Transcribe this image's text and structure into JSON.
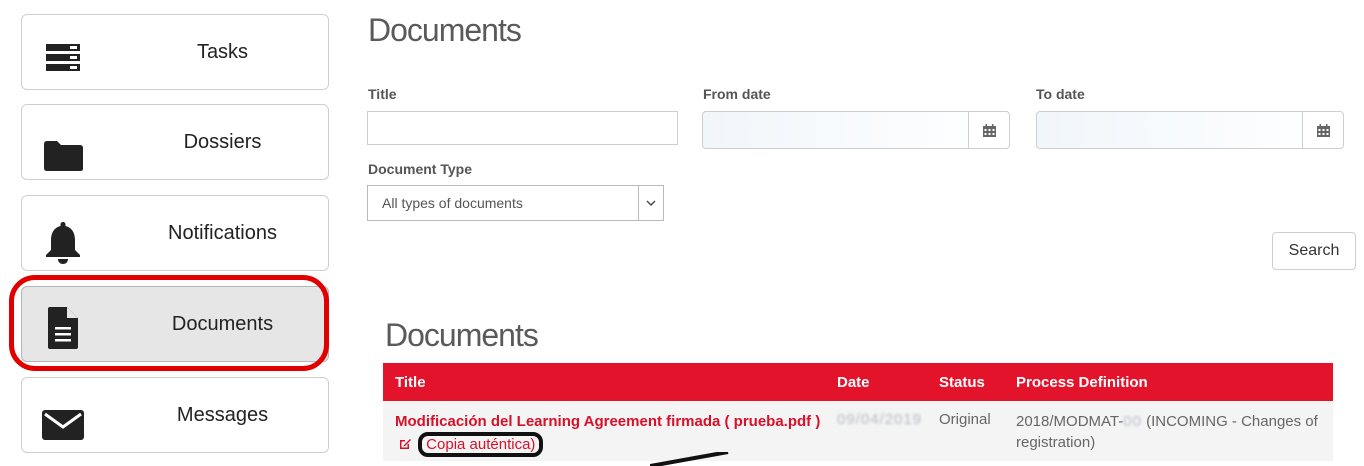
{
  "sidebar": {
    "items": [
      {
        "label": "Tasks",
        "icon": "server-icon"
      },
      {
        "label": "Dossiers",
        "icon": "folder-icon"
      },
      {
        "label": "Notifications",
        "icon": "bell-icon"
      },
      {
        "label": "Documents",
        "icon": "document-icon"
      },
      {
        "label": "Messages",
        "icon": "envelope-icon"
      }
    ],
    "active": "Documents"
  },
  "filters": {
    "page_title": "Documents",
    "title_label": "Title",
    "title_value": "",
    "from_date_label": "From date",
    "from_date_value": "",
    "to_date_label": "To date",
    "to_date_value": "",
    "document_type_label": "Document Type",
    "document_type_value": "All types of documents",
    "search_label": "Search"
  },
  "results": {
    "title": "Documents",
    "columns": [
      "Title",
      "Date",
      "Status",
      "Process Definition"
    ],
    "rows": [
      {
        "title": "Modificación del Learning Agreement firmada ( prueba.pdf )",
        "copy_link": "Copia auténtica)",
        "date": "09/04/2019",
        "status": "Original",
        "process_definition_prefix": "2018/MODMAT-",
        "process_definition_redacted": "00",
        "process_definition_suffix": " (INCOMING - Changes of registration)"
      }
    ]
  },
  "colors": {
    "accent": "#e3132c",
    "highlight": "#e00000"
  }
}
